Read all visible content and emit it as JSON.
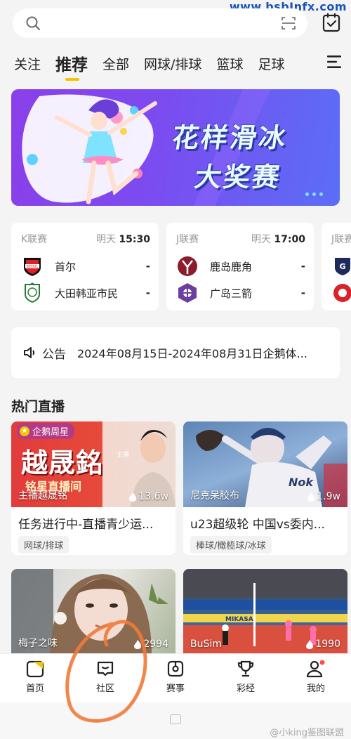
{
  "watermark_top": "www.bsbInfx.com",
  "search": {
    "placeholder": ""
  },
  "tabs": [
    {
      "label": "关注"
    },
    {
      "label": "推荐"
    },
    {
      "label": "全部"
    },
    {
      "label": "网球/排球"
    },
    {
      "label": "篮球"
    },
    {
      "label": "足球"
    }
  ],
  "banner": {
    "title_line1": "花样滑冰",
    "title_line2": "大奖赛"
  },
  "matches": [
    {
      "league": "K联赛",
      "day": "明天",
      "time": "15:30",
      "teams": [
        {
          "name": "首尔",
          "score": "-"
        },
        {
          "name": "大田韩亚市民",
          "score": "-"
        }
      ]
    },
    {
      "league": "J联赛",
      "day": "明天",
      "time": "17:00",
      "teams": [
        {
          "name": "鹿岛鹿角",
          "score": "-"
        },
        {
          "name": "广岛三箭",
          "score": "-"
        }
      ]
    },
    {
      "league": "J联赛",
      "day": "",
      "time": "",
      "teams": []
    }
  ],
  "notice": {
    "label": "公告",
    "text": "2024年08月15日-2024年08月31日企鹅体..."
  },
  "section_title": "热门直播",
  "live": [
    {
      "badge": "企鹅周星",
      "promo_big": "越晟銘",
      "promo_small": "铭星直播间",
      "promo_tags": "主播",
      "streamer": "主播越晟铭",
      "views": "13.6w",
      "title": "任务进行中-直播青少运...",
      "tag": "网球/排球"
    },
    {
      "streamer": "尼克呆胶布",
      "views": "1.9w",
      "title": "u23超级轮 中国vs委内...",
      "tag": "棒球/橄榄球/冰球"
    },
    {
      "streamer": "梅子之味",
      "views": "2994"
    },
    {
      "streamer": "BuSim",
      "views": "1990",
      "board_text": "MIKASA"
    }
  ],
  "nav": [
    {
      "label": "首页"
    },
    {
      "label": "社区"
    },
    {
      "label": "赛事"
    },
    {
      "label": "彩经"
    },
    {
      "label": "我的"
    }
  ],
  "watermark_bottom": "@小king鉴图联盟",
  "colors": {
    "accent": "#f4c400",
    "banner": "#7b4cf0",
    "annotation": "#f07a3a"
  }
}
